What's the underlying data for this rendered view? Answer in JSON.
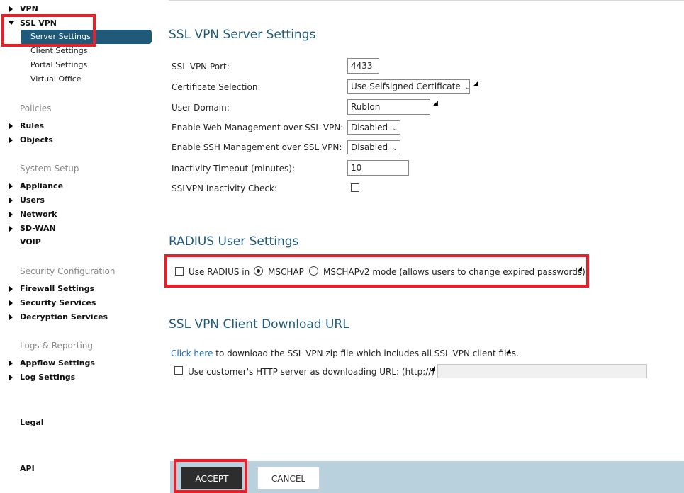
{
  "sidebar": {
    "vpn": "VPN",
    "ssl_vpn": "SSL VPN",
    "ssl_vpn_items": [
      "Server Settings",
      "Client Settings",
      "Portal Settings",
      "Virtual Office"
    ],
    "policies_head": "Policies",
    "rules": "Rules",
    "objects": "Objects",
    "system_setup_head": "System Setup",
    "appliance": "Appliance",
    "users": "Users",
    "network": "Network",
    "sd_wan": "SD-WAN",
    "voip": "VOIP",
    "security_config_head": "Security Configuration",
    "firewall_settings": "Firewall Settings",
    "security_services": "Security Services",
    "decryption_services": "Decryption Services",
    "logs_reporting_head": "Logs & Reporting",
    "appflow_settings": "Appflow Settings",
    "log_settings": "Log Settings",
    "legal": "Legal",
    "api": "API"
  },
  "server_settings": {
    "heading": "SSL VPN Server Settings",
    "port_label": "SSL VPN Port:",
    "port_value": "4433",
    "cert_label": "Certificate Selection:",
    "cert_value": "Use Selfsigned Certificate",
    "domain_label": "User Domain:",
    "domain_value": "Rublon",
    "web_mgmt_label": "Enable Web Management over SSL VPN:",
    "web_mgmt_value": "Disabled",
    "ssh_mgmt_label": "Enable SSH Management over SSL VPN:",
    "ssh_mgmt_value": "Disabled",
    "timeout_label": "Inactivity Timeout (minutes):",
    "timeout_value": "10",
    "inactivity_check_label": "SSLVPN Inactivity Check:"
  },
  "radius": {
    "heading": "RADIUS User Settings",
    "use_radius_label": "Use RADIUS in",
    "mschap_label": "MSCHAP",
    "mschapv2_label": "MSCHAPv2 mode (allows users to change expired passwords)"
  },
  "download": {
    "heading": "SSL VPN Client Download URL",
    "click_here": "Click here",
    "download_text": "to download the SSL VPN zip file which includes all SSL VPN client files.",
    "custom_server_label": "Use customer's HTTP server as downloading URL: (http://)"
  },
  "buttons": {
    "accept": "ACCEPT",
    "cancel": "CANCEL"
  },
  "colors": {
    "accent": "#1f5a7a",
    "highlight": "#e8202a",
    "button_bar": "#b8d1dc"
  }
}
